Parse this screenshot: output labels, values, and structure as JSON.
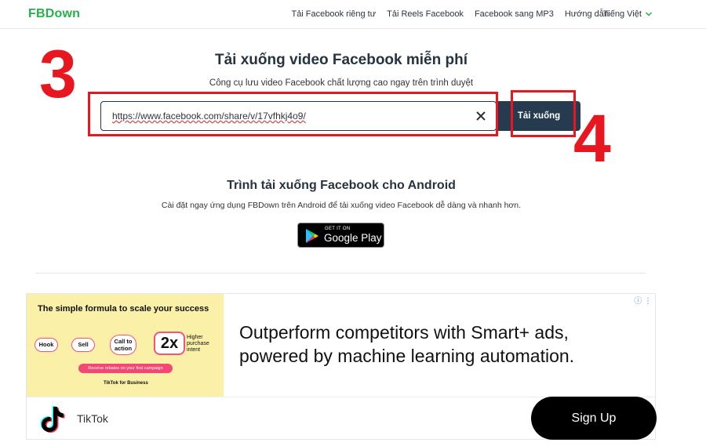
{
  "header": {
    "logo": "FBDown",
    "nav": [
      "Tải Facebook riêng tư",
      "Tải Reels Facebook",
      "Facebook sang MP3",
      "Hướng dẫn"
    ],
    "language": "Tiếng Việt"
  },
  "hero": {
    "title": "Tải xuống video Facebook miễn phí",
    "subtitle": "Công cụ lưu video Facebook chất lượng cao ngay trên trình duyệt",
    "url_value": "https://www.facebook.com/share/v/17vfhkj4o9/",
    "download_label": "Tải xuống"
  },
  "annotations": {
    "step_input": "3",
    "step_button": "4",
    "color": "#e8161e"
  },
  "android": {
    "title": "Trình tải xuống Facebook cho Android",
    "subtitle": "Cài đặt ngay ứng dụng FBDown trên Android để tải xuống video Facebook dễ dàng và nhanh hơn.",
    "badge_small": "GET IT ON",
    "badge_big": "Google Play"
  },
  "ad": {
    "image_title": "The simple formula to scale your success",
    "flow": [
      "Hook",
      "Sell",
      "Call to action"
    ],
    "flow_big": "2x",
    "flow_big_caption": "Higher purchase intent",
    "promo": "Receive rebates on your first campaign",
    "image_brand": "TikTok for Business",
    "headline": "Outperform competitors with Smart+ ads, powered by machine learning automation.",
    "brand": "TikTok",
    "cta": "Sign Up"
  },
  "colors": {
    "brand_green": "#27b14a",
    "button_dark": "#263b4f",
    "ad_yellow": "#fbf0a8"
  }
}
